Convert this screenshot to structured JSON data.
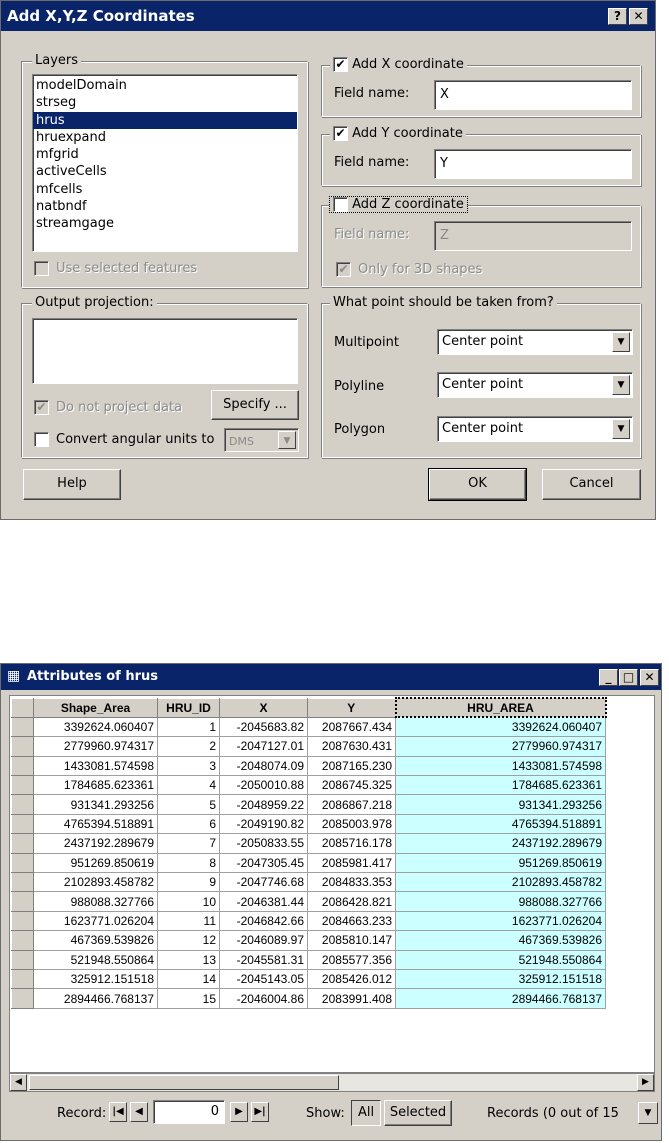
{
  "dialog": {
    "title": "Add X,Y,Z Coordinates",
    "title_buttons": {
      "help": "?",
      "close": "✕"
    },
    "layers": {
      "legend": "Layers",
      "items": [
        "modelDomain",
        "strseg",
        "hrus",
        "hruexpand",
        "mfgrid",
        "activeCells",
        "mfcells",
        "natbndf",
        "streamgage"
      ],
      "selected": "hrus",
      "use_selected_label": "Use selected features"
    },
    "add_x": {
      "label": "Add X coordinate",
      "checked": "✔",
      "field_label": "Field name:",
      "value": "X"
    },
    "add_y": {
      "label": "Add Y coordinate",
      "checked": "✔",
      "field_label": "Field name:",
      "value": "Y"
    },
    "add_z": {
      "label": "Add Z coordinate",
      "checked": "",
      "field_label": "Field name:",
      "value": "Z",
      "only_3d_label": "Only for 3D shapes",
      "only_3d_checked": "✔"
    },
    "output_projection": {
      "legend": "Output projection:",
      "do_not_project_label": "Do not project data",
      "do_not_project_checked": "✔",
      "specify_button": "Specify ...",
      "convert_label": "Convert angular units to",
      "units_value": "DMS"
    },
    "point_from": {
      "legend": "What point should be taken from?",
      "multipoint_label": "Multipoint",
      "multipoint_value": "Center point",
      "polyline_label": "Polyline",
      "polyline_value": "Center point",
      "polygon_label": "Polygon",
      "polygon_value": "Center point"
    },
    "buttons": {
      "help": "Help",
      "ok": "OK",
      "cancel": "Cancel"
    }
  },
  "attributes": {
    "title": "Attributes of hrus",
    "title_buttons": {
      "minimize": "_",
      "maximize": "□",
      "close": "✕"
    },
    "columns": [
      "Shape_Area",
      "HRU_ID",
      "X",
      "Y",
      "HRU_AREA"
    ],
    "rows": [
      [
        "3392624.060407",
        "1",
        "-2045683.82",
        "2087667.434",
        "3392624.060407"
      ],
      [
        "2779960.974317",
        "2",
        "-2047127.01",
        "2087630.431",
        "2779960.974317"
      ],
      [
        "1433081.574598",
        "3",
        "-2048074.09",
        "2087165.230",
        "1433081.574598"
      ],
      [
        "1784685.623361",
        "4",
        "-2050010.88",
        "2086745.325",
        "1784685.623361"
      ],
      [
        "931341.293256",
        "5",
        "-2048959.22",
        "2086867.218",
        "931341.293256"
      ],
      [
        "4765394.518891",
        "6",
        "-2049190.82",
        "2085003.978",
        "4765394.518891"
      ],
      [
        "2437192.289679",
        "7",
        "-2050833.55",
        "2085716.178",
        "2437192.289679"
      ],
      [
        "951269.850619",
        "8",
        "-2047305.45",
        "2085981.417",
        "951269.850619"
      ],
      [
        "2102893.458782",
        "9",
        "-2047746.68",
        "2084833.353",
        "2102893.458782"
      ],
      [
        "988088.327766",
        "10",
        "-2046381.44",
        "2086428.821",
        "988088.327766"
      ],
      [
        "1623771.026204",
        "11",
        "-2046842.66",
        "2084663.233",
        "1623771.026204"
      ],
      [
        "467369.539826",
        "12",
        "-2046089.97",
        "2085810.147",
        "467369.539826"
      ],
      [
        "521948.550864",
        "13",
        "-2045581.31",
        "2085577.356",
        "521948.550864"
      ],
      [
        "325912.151518",
        "14",
        "-2045143.05",
        "2085426.012",
        "325912.151518"
      ],
      [
        "2894466.768137",
        "15",
        "-2046004.86",
        "2083991.408",
        "2894466.768137"
      ]
    ],
    "footer": {
      "record_label": "Record:",
      "record_value": "0",
      "show_label": "Show:",
      "all_button": "All",
      "selected_button": "Selected",
      "records_text": "Records (0 out of 15"
    },
    "icons": {
      "first": "|◀",
      "prev": "◀",
      "next": "▶",
      "last": "▶|",
      "table": "▦"
    }
  }
}
